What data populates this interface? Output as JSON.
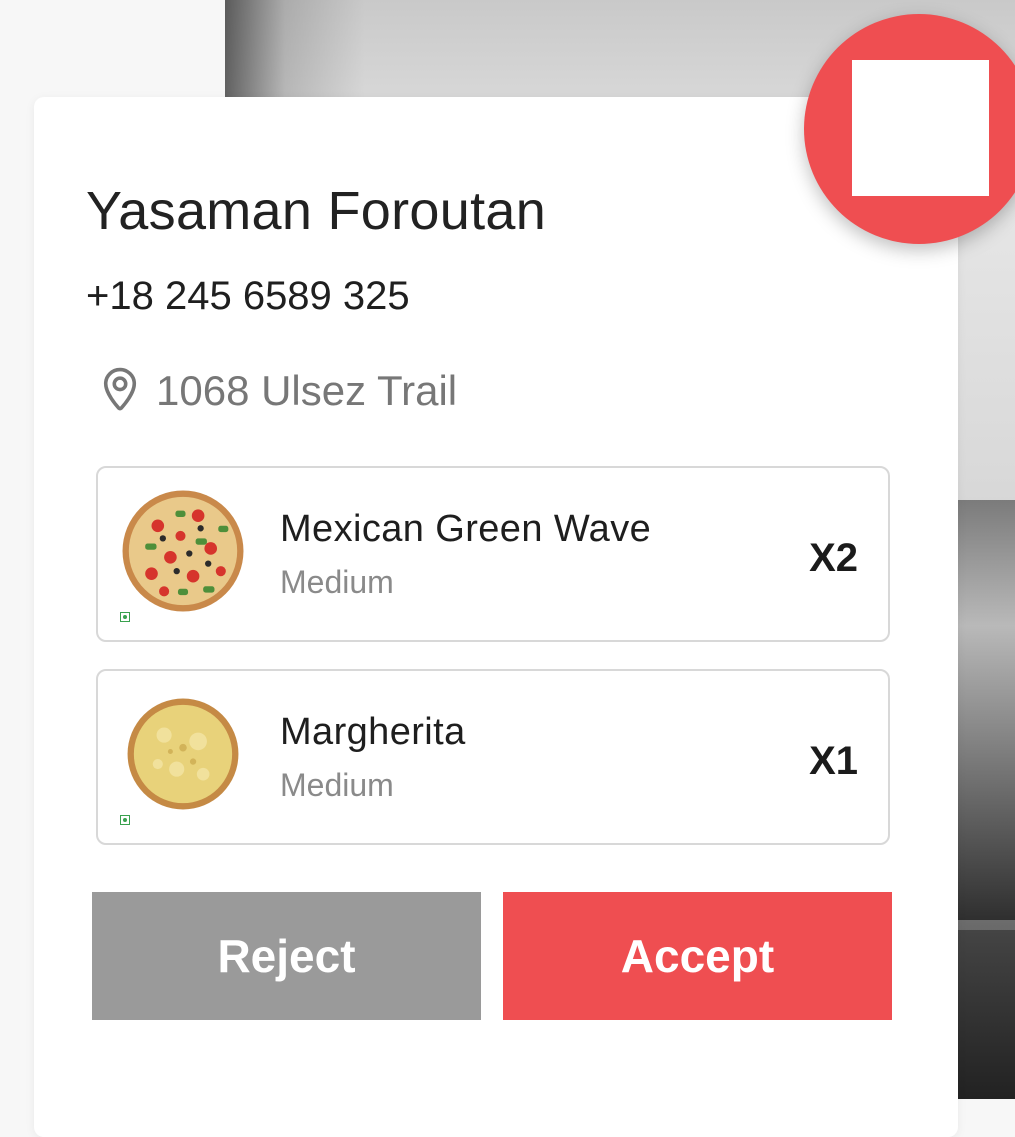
{
  "order": {
    "customer_name": "Yasaman Foroutan",
    "phone": "+18 245 6589 325",
    "address": "1068 Ulsez Trail",
    "address_icon": "location-pin-icon"
  },
  "items": [
    {
      "name": "Mexican Green Wave",
      "size": "Medium",
      "quantity": "X2",
      "thumb_icon": "pizza-toppings-image"
    },
    {
      "name": "Margherita",
      "size": "Medium",
      "quantity": "X1",
      "thumb_icon": "pizza-cheese-image"
    }
  ],
  "actions": {
    "reject_label": "Reject",
    "accept_label": "Accept"
  },
  "colors": {
    "accent": "#ef4e51",
    "reject": "#9a9a9a",
    "text": "#1e1e1e",
    "muted": "#8a8a8a"
  }
}
